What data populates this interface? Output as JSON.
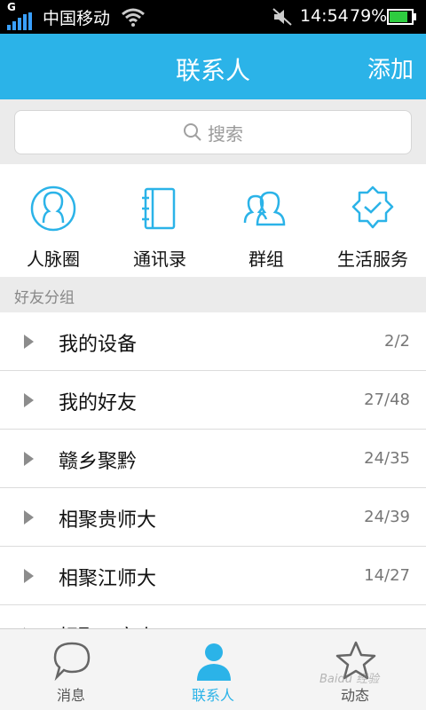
{
  "status_bar": {
    "network": "G",
    "carrier": "中国移动",
    "time": "14:54",
    "battery": "79%"
  },
  "header": {
    "title": "联系人",
    "add_label": "添加"
  },
  "search": {
    "placeholder": "搜索"
  },
  "quick_actions": [
    {
      "label": "人脉圈",
      "icon": "person-circle-icon"
    },
    {
      "label": "通讯录",
      "icon": "address-book-icon"
    },
    {
      "label": "群组",
      "icon": "group-icon"
    },
    {
      "label": "生活服务",
      "icon": "service-badge-icon"
    }
  ],
  "group_section": {
    "title": "好友分组",
    "groups": [
      {
        "name": "我的设备",
        "count": "2/2"
      },
      {
        "name": "我的好友",
        "count": "27/48"
      },
      {
        "name": "赣乡聚黔",
        "count": "24/35"
      },
      {
        "name": "相聚贵师大",
        "count": "24/39"
      },
      {
        "name": "相聚江师大",
        "count": "14/27"
      },
      {
        "name": "相聚一家人",
        "count": ""
      }
    ]
  },
  "tabs": [
    {
      "label": "消息",
      "icon": "chat-bubble-icon",
      "active": false
    },
    {
      "label": "联系人",
      "icon": "contact-person-icon",
      "active": true
    },
    {
      "label": "动态",
      "icon": "star-icon",
      "active": false
    }
  ],
  "colors": {
    "accent": "#2bb3e8",
    "background_gray": "#ebebeb"
  },
  "watermark": "Baidu 经验"
}
